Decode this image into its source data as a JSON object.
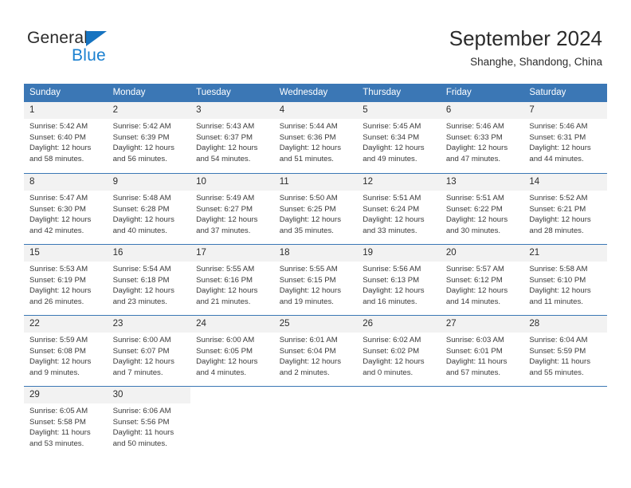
{
  "brand": {
    "name_top": "General",
    "name_bottom": "Blue",
    "triangle_color": "#1673c0",
    "blue_text_color": "#1a80d0"
  },
  "header": {
    "title": "September 2024",
    "subtitle": "Shanghe, Shandong, China"
  },
  "theme": {
    "header_blue": "#3b77b5",
    "day_number_band": "#f2f2f2",
    "text": "#2b2b2b"
  },
  "calendar": {
    "weekdays": [
      "Sunday",
      "Monday",
      "Tuesday",
      "Wednesday",
      "Thursday",
      "Friday",
      "Saturday"
    ],
    "weeks": [
      [
        {
          "day": "1",
          "sunrise": "Sunrise: 5:42 AM",
          "sunset": "Sunset: 6:40 PM",
          "daylight": "Daylight: 12 hours and 58 minutes."
        },
        {
          "day": "2",
          "sunrise": "Sunrise: 5:42 AM",
          "sunset": "Sunset: 6:39 PM",
          "daylight": "Daylight: 12 hours and 56 minutes."
        },
        {
          "day": "3",
          "sunrise": "Sunrise: 5:43 AM",
          "sunset": "Sunset: 6:37 PM",
          "daylight": "Daylight: 12 hours and 54 minutes."
        },
        {
          "day": "4",
          "sunrise": "Sunrise: 5:44 AM",
          "sunset": "Sunset: 6:36 PM",
          "daylight": "Daylight: 12 hours and 51 minutes."
        },
        {
          "day": "5",
          "sunrise": "Sunrise: 5:45 AM",
          "sunset": "Sunset: 6:34 PM",
          "daylight": "Daylight: 12 hours and 49 minutes."
        },
        {
          "day": "6",
          "sunrise": "Sunrise: 5:46 AM",
          "sunset": "Sunset: 6:33 PM",
          "daylight": "Daylight: 12 hours and 47 minutes."
        },
        {
          "day": "7",
          "sunrise": "Sunrise: 5:46 AM",
          "sunset": "Sunset: 6:31 PM",
          "daylight": "Daylight: 12 hours and 44 minutes."
        }
      ],
      [
        {
          "day": "8",
          "sunrise": "Sunrise: 5:47 AM",
          "sunset": "Sunset: 6:30 PM",
          "daylight": "Daylight: 12 hours and 42 minutes."
        },
        {
          "day": "9",
          "sunrise": "Sunrise: 5:48 AM",
          "sunset": "Sunset: 6:28 PM",
          "daylight": "Daylight: 12 hours and 40 minutes."
        },
        {
          "day": "10",
          "sunrise": "Sunrise: 5:49 AM",
          "sunset": "Sunset: 6:27 PM",
          "daylight": "Daylight: 12 hours and 37 minutes."
        },
        {
          "day": "11",
          "sunrise": "Sunrise: 5:50 AM",
          "sunset": "Sunset: 6:25 PM",
          "daylight": "Daylight: 12 hours and 35 minutes."
        },
        {
          "day": "12",
          "sunrise": "Sunrise: 5:51 AM",
          "sunset": "Sunset: 6:24 PM",
          "daylight": "Daylight: 12 hours and 33 minutes."
        },
        {
          "day": "13",
          "sunrise": "Sunrise: 5:51 AM",
          "sunset": "Sunset: 6:22 PM",
          "daylight": "Daylight: 12 hours and 30 minutes."
        },
        {
          "day": "14",
          "sunrise": "Sunrise: 5:52 AM",
          "sunset": "Sunset: 6:21 PM",
          "daylight": "Daylight: 12 hours and 28 minutes."
        }
      ],
      [
        {
          "day": "15",
          "sunrise": "Sunrise: 5:53 AM",
          "sunset": "Sunset: 6:19 PM",
          "daylight": "Daylight: 12 hours and 26 minutes."
        },
        {
          "day": "16",
          "sunrise": "Sunrise: 5:54 AM",
          "sunset": "Sunset: 6:18 PM",
          "daylight": "Daylight: 12 hours and 23 minutes."
        },
        {
          "day": "17",
          "sunrise": "Sunrise: 5:55 AM",
          "sunset": "Sunset: 6:16 PM",
          "daylight": "Daylight: 12 hours and 21 minutes."
        },
        {
          "day": "18",
          "sunrise": "Sunrise: 5:55 AM",
          "sunset": "Sunset: 6:15 PM",
          "daylight": "Daylight: 12 hours and 19 minutes."
        },
        {
          "day": "19",
          "sunrise": "Sunrise: 5:56 AM",
          "sunset": "Sunset: 6:13 PM",
          "daylight": "Daylight: 12 hours and 16 minutes."
        },
        {
          "day": "20",
          "sunrise": "Sunrise: 5:57 AM",
          "sunset": "Sunset: 6:12 PM",
          "daylight": "Daylight: 12 hours and 14 minutes."
        },
        {
          "day": "21",
          "sunrise": "Sunrise: 5:58 AM",
          "sunset": "Sunset: 6:10 PM",
          "daylight": "Daylight: 12 hours and 11 minutes."
        }
      ],
      [
        {
          "day": "22",
          "sunrise": "Sunrise: 5:59 AM",
          "sunset": "Sunset: 6:08 PM",
          "daylight": "Daylight: 12 hours and 9 minutes."
        },
        {
          "day": "23",
          "sunrise": "Sunrise: 6:00 AM",
          "sunset": "Sunset: 6:07 PM",
          "daylight": "Daylight: 12 hours and 7 minutes."
        },
        {
          "day": "24",
          "sunrise": "Sunrise: 6:00 AM",
          "sunset": "Sunset: 6:05 PM",
          "daylight": "Daylight: 12 hours and 4 minutes."
        },
        {
          "day": "25",
          "sunrise": "Sunrise: 6:01 AM",
          "sunset": "Sunset: 6:04 PM",
          "daylight": "Daylight: 12 hours and 2 minutes."
        },
        {
          "day": "26",
          "sunrise": "Sunrise: 6:02 AM",
          "sunset": "Sunset: 6:02 PM",
          "daylight": "Daylight: 12 hours and 0 minutes."
        },
        {
          "day": "27",
          "sunrise": "Sunrise: 6:03 AM",
          "sunset": "Sunset: 6:01 PM",
          "daylight": "Daylight: 11 hours and 57 minutes."
        },
        {
          "day": "28",
          "sunrise": "Sunrise: 6:04 AM",
          "sunset": "Sunset: 5:59 PM",
          "daylight": "Daylight: 11 hours and 55 minutes."
        }
      ],
      [
        {
          "day": "29",
          "sunrise": "Sunrise: 6:05 AM",
          "sunset": "Sunset: 5:58 PM",
          "daylight": "Daylight: 11 hours and 53 minutes."
        },
        {
          "day": "30",
          "sunrise": "Sunrise: 6:06 AM",
          "sunset": "Sunset: 5:56 PM",
          "daylight": "Daylight: 11 hours and 50 minutes."
        },
        {
          "day": "",
          "sunrise": "",
          "sunset": "",
          "daylight": ""
        },
        {
          "day": "",
          "sunrise": "",
          "sunset": "",
          "daylight": ""
        },
        {
          "day": "",
          "sunrise": "",
          "sunset": "",
          "daylight": ""
        },
        {
          "day": "",
          "sunrise": "",
          "sunset": "",
          "daylight": ""
        },
        {
          "day": "",
          "sunrise": "",
          "sunset": "",
          "daylight": ""
        }
      ]
    ]
  }
}
